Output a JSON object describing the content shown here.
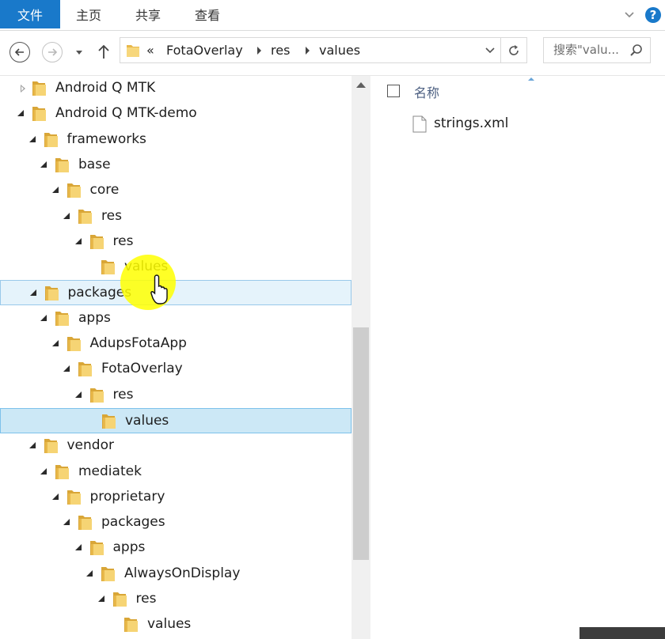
{
  "ribbon": {
    "file_tab": "文件",
    "tabs": [
      "主页",
      "共享",
      "查看"
    ],
    "help_label": "?"
  },
  "address": {
    "overflow": "«",
    "crumbs": [
      "FotaOverlay",
      "res",
      "values"
    ],
    "search_placeholder": "搜索\"valu..."
  },
  "tree": [
    {
      "label": "Android Q MTK",
      "level": 0,
      "state": "closed"
    },
    {
      "label": "Android Q MTK-demo",
      "level": 0,
      "state": "open"
    },
    {
      "label": "frameworks",
      "level": 1,
      "state": "open"
    },
    {
      "label": "base",
      "level": 2,
      "state": "open"
    },
    {
      "label": "core",
      "level": 3,
      "state": "open"
    },
    {
      "label": "res",
      "level": 4,
      "state": "open"
    },
    {
      "label": "res",
      "level": 5,
      "state": "open"
    },
    {
      "label": "values",
      "level": 6,
      "state": "none"
    },
    {
      "label": "packages",
      "level": 1,
      "state": "open",
      "hover": true
    },
    {
      "label": "apps",
      "level": 2,
      "state": "open"
    },
    {
      "label": "AdupsFotaApp",
      "level": 3,
      "state": "open"
    },
    {
      "label": "FotaOverlay",
      "level": 4,
      "state": "open"
    },
    {
      "label": "res",
      "level": 5,
      "state": "open"
    },
    {
      "label": "values",
      "level": 6,
      "state": "none",
      "selected": true
    },
    {
      "label": "vendor",
      "level": 1,
      "state": "open"
    },
    {
      "label": "mediatek",
      "level": 2,
      "state": "open"
    },
    {
      "label": "proprietary",
      "level": 3,
      "state": "open"
    },
    {
      "label": "packages",
      "level": 4,
      "state": "open"
    },
    {
      "label": "apps",
      "level": 5,
      "state": "open"
    },
    {
      "label": "AlwaysOnDisplay",
      "level": 6,
      "state": "open"
    },
    {
      "label": "res",
      "level": 7,
      "state": "open"
    },
    {
      "label": "values",
      "level": 8,
      "state": "none"
    }
  ],
  "content": {
    "column_name": "名称",
    "files": [
      "strings.xml"
    ]
  },
  "colors": {
    "accent": "#1979ca",
    "selection": "#cce8f6",
    "hover": "#e5f3fb",
    "folder": "#e8b84a"
  },
  "icons": {
    "back": "back-arrow-icon",
    "forward": "forward-arrow-icon",
    "up": "up-arrow-icon",
    "refresh": "refresh-icon",
    "search": "search-icon",
    "help": "help-icon",
    "folder": "folder-icon",
    "file": "file-icon"
  }
}
